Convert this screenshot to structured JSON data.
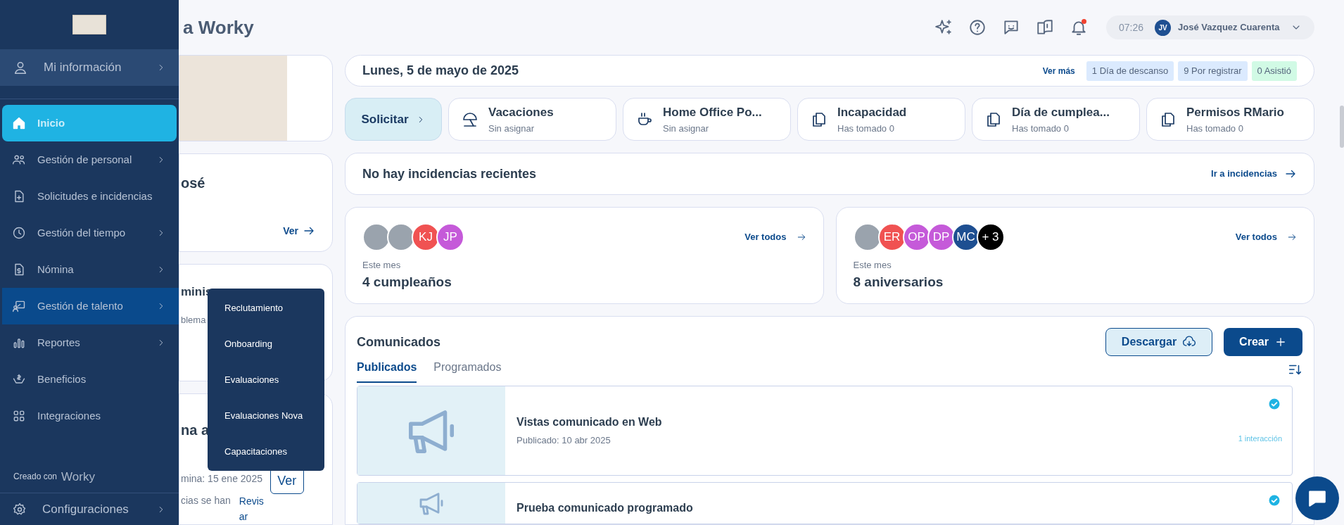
{
  "header": {
    "title": "a Worky",
    "time": "07:26",
    "user_initials": "JV",
    "user_name": "José Vazquez Cuarenta",
    "notification_dot": true
  },
  "sidebar": {
    "profile": {
      "label": "Mi información"
    },
    "items": [
      {
        "label": "Inicio",
        "selected": true,
        "hovered": false,
        "has_submenu": false
      },
      {
        "label": "Gestión de personal",
        "selected": false,
        "hovered": false,
        "has_submenu": true
      },
      {
        "label": "Solicitudes e incidencias",
        "selected": false,
        "hovered": false,
        "has_submenu": false
      },
      {
        "label": "Gestión del tiempo",
        "selected": false,
        "hovered": false,
        "has_submenu": true
      },
      {
        "label": "Nómina",
        "selected": false,
        "hovered": false,
        "has_submenu": true
      },
      {
        "label": "Gestión de talento",
        "selected": false,
        "hovered": true,
        "has_submenu": true
      },
      {
        "label": "Reportes",
        "selected": false,
        "hovered": false,
        "has_submenu": true
      },
      {
        "label": "Beneficios",
        "selected": false,
        "hovered": false,
        "has_submenu": false
      },
      {
        "label": "Integraciones",
        "selected": false,
        "hovered": false,
        "has_submenu": false
      }
    ],
    "created_with": "Creado con",
    "brand": "Worky",
    "settings": "Configuraciones"
  },
  "submenu": [
    "Reclutamiento",
    "Onboarding",
    "Evaluaciones",
    "Evaluaciones Nova",
    "Capacitaciones"
  ],
  "left_cards": {
    "greeting": "osé",
    "greeting_link": "Ver",
    "admin_title": "minis",
    "admin_text": "blema",
    "payroll_title": "na a",
    "payroll_date": "mina: 15 ene 2025",
    "payroll_text": "cias se han",
    "payroll_link": "Revis ar",
    "payroll_button": "Ver"
  },
  "date_bar": {
    "date": "Lunes, 5 de mayo de 2025",
    "link": "Ver más",
    "badges": [
      {
        "label": "1 Día de descanso",
        "color": "#dbeafe"
      },
      {
        "label": "9 Por registrar",
        "color": "#dbeafe"
      },
      {
        "label": "0 Asistió",
        "color": "#d1fae5"
      }
    ]
  },
  "requests": {
    "button": "Solicitar",
    "items": [
      {
        "title": "Vacaciones",
        "subtitle": "Sin asignar"
      },
      {
        "title": "Home Office Po...",
        "subtitle": "Sin asignar"
      },
      {
        "title": "Incapacidad",
        "subtitle": "Has tomado 0"
      },
      {
        "title": "Día de cumplea...",
        "subtitle": "Has tomado 0"
      },
      {
        "title": "Permisos RMario",
        "subtitle": "Has tomado 0"
      }
    ]
  },
  "incidents": {
    "text": "No hay incidencias recientes",
    "link": "Ir a incidencias"
  },
  "celebrations": [
    {
      "avatars": [
        {
          "kind": "photo"
        },
        {
          "kind": "photo"
        },
        {
          "kind": "initials",
          "text": "KJ",
          "color": "#f05252"
        },
        {
          "kind": "initials",
          "text": "JP",
          "color": "#c55ad9"
        }
      ],
      "link": "Ver todos",
      "caption": "Este mes",
      "count": "4 cumpleaños"
    },
    {
      "avatars": [
        {
          "kind": "photo"
        },
        {
          "kind": "initials",
          "text": "ER",
          "color": "#f05252"
        },
        {
          "kind": "initials",
          "text": "OP",
          "color": "#c55ad9"
        },
        {
          "kind": "initials",
          "text": "DP",
          "color": "#c55ad9"
        },
        {
          "kind": "initials",
          "text": "MC",
          "color": "#1e4f91"
        },
        {
          "kind": "initials",
          "text": "+ 3",
          "color": "#000000"
        }
      ],
      "link": "Ver todos",
      "caption": "Este mes",
      "count": "8 aniversarios"
    }
  ],
  "announcements": {
    "title": "Comunicados",
    "download": "Descargar",
    "create": "Crear",
    "tabs": [
      {
        "label": "Publicados",
        "selected": true
      },
      {
        "label": "Programados",
        "selected": false
      }
    ],
    "posts": [
      {
        "title": "Vistas comunicado en Web",
        "date": "Publicado: 10 abr 2025",
        "interactions": "1 interacción",
        "checked": true
      },
      {
        "title": "Prueba comunicado programado",
        "checked": true
      }
    ]
  }
}
